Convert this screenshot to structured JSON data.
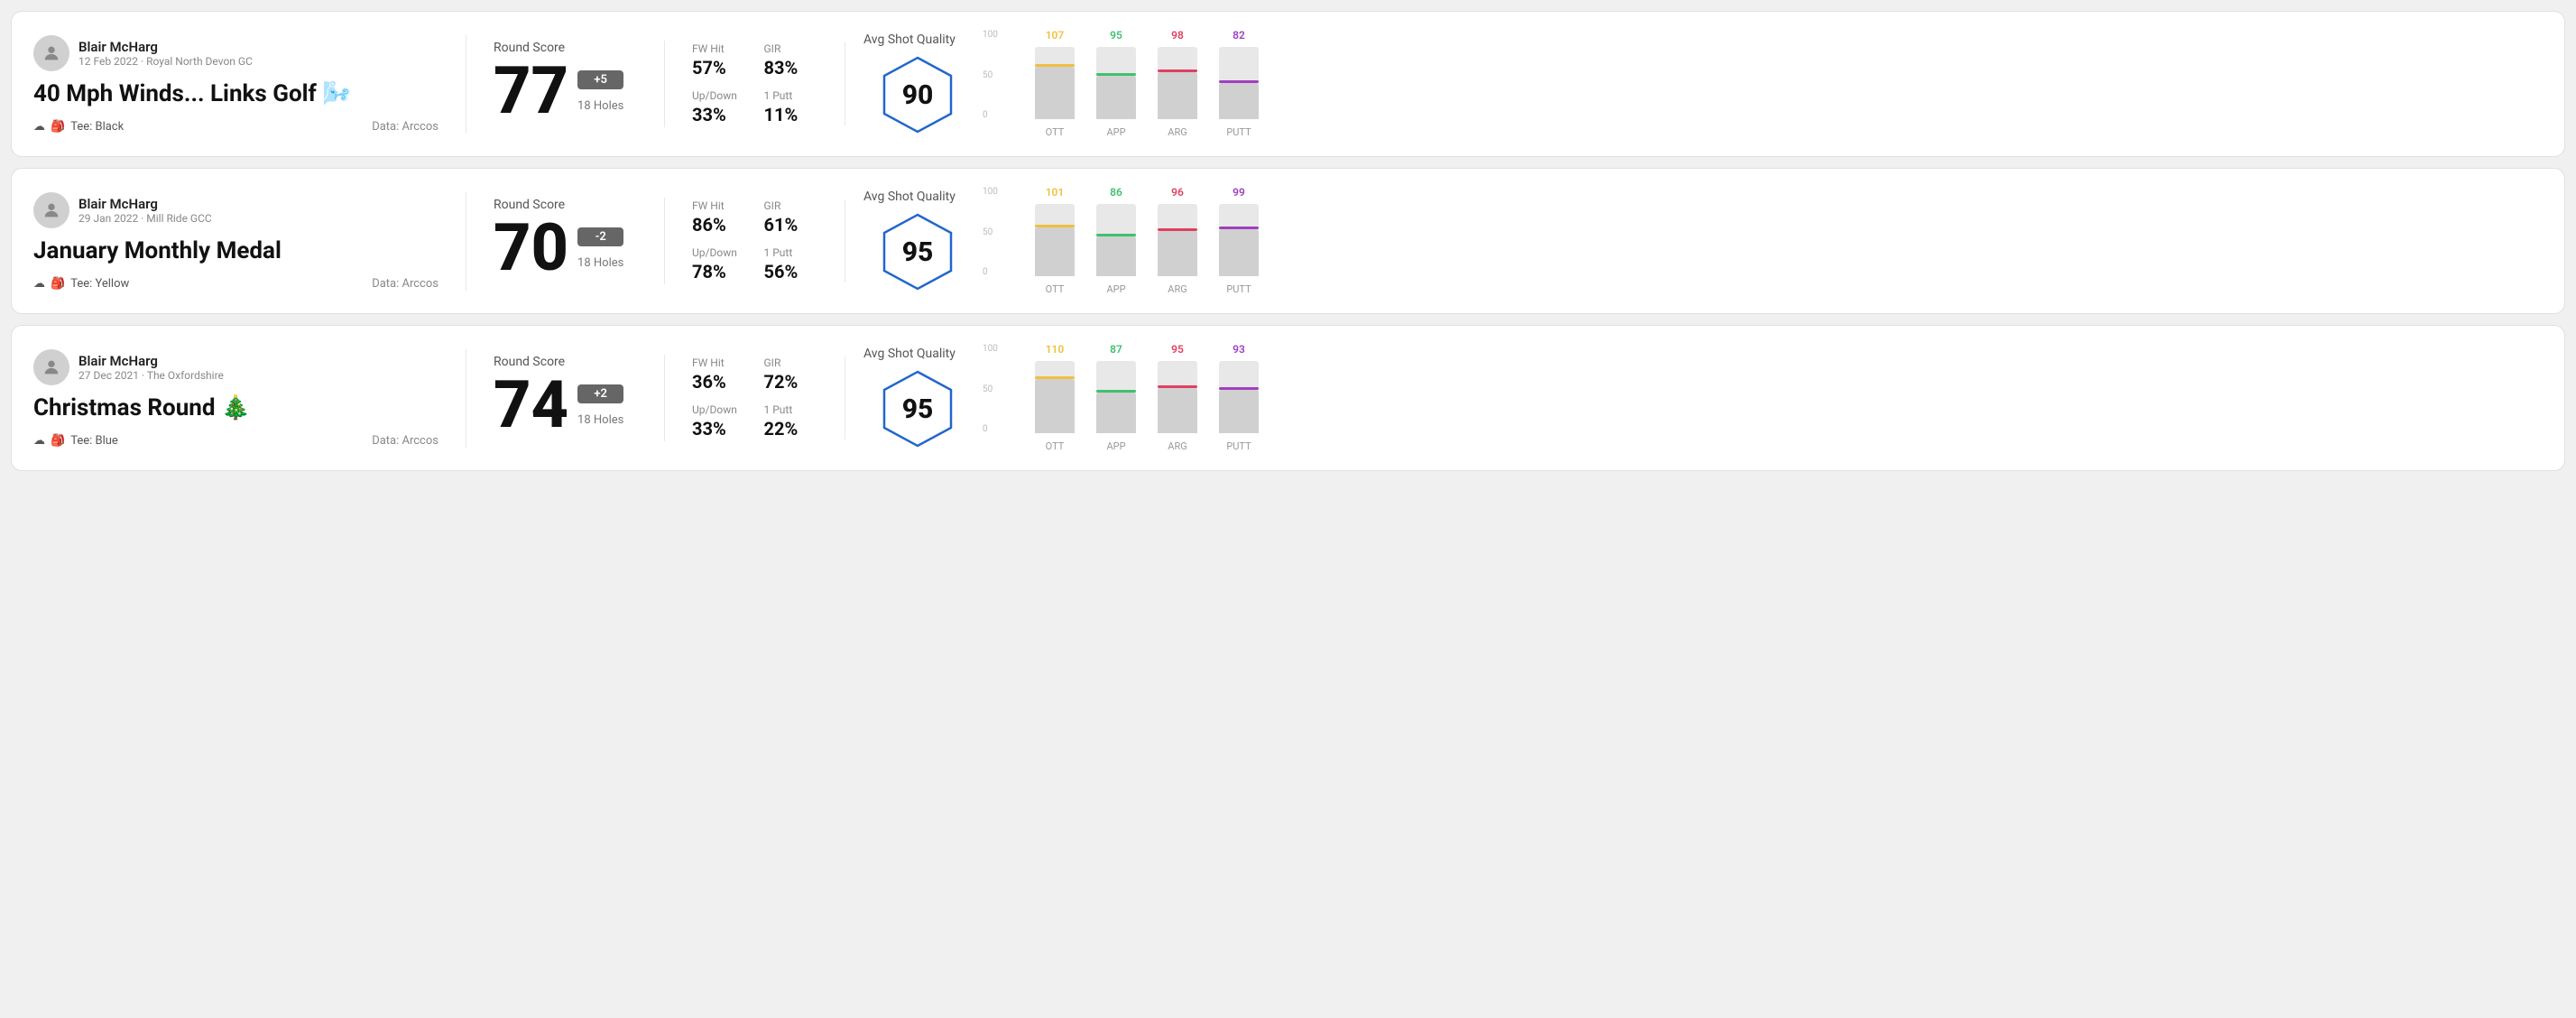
{
  "rounds": [
    {
      "id": "round1",
      "user_name": "Blair McHarg",
      "date_course": "12 Feb 2022 · Royal North Devon GC",
      "title": "40 Mph Winds... Links Golf 🌬️",
      "tee": "Black",
      "data_source": "Data: Arccos",
      "round_score_label": "Round Score",
      "score": "77",
      "score_diff": "+5",
      "score_diff_sign": "positive",
      "holes": "18 Holes",
      "fw_hit_label": "FW Hit",
      "fw_hit": "57%",
      "gir_label": "GIR",
      "gir": "83%",
      "updown_label": "Up/Down",
      "updown": "33%",
      "oneputt_label": "1 Putt",
      "oneputt": "11%",
      "quality_label": "Avg Shot Quality",
      "quality_score": "90",
      "chart": {
        "bars": [
          {
            "label": "OTT",
            "value": 107,
            "color": "#f0c040",
            "fill_pct": 72
          },
          {
            "label": "APP",
            "value": 95,
            "color": "#40c070",
            "fill_pct": 60
          },
          {
            "label": "ARG",
            "value": 98,
            "color": "#e04060",
            "fill_pct": 65
          },
          {
            "label": "PUTT",
            "value": 82,
            "color": "#a040c0",
            "fill_pct": 50
          }
        ]
      }
    },
    {
      "id": "round2",
      "user_name": "Blair McHarg",
      "date_course": "29 Jan 2022 · Mill Ride GCC",
      "title": "January Monthly Medal",
      "tee": "Yellow",
      "data_source": "Data: Arccos",
      "round_score_label": "Round Score",
      "score": "70",
      "score_diff": "-2",
      "score_diff_sign": "negative",
      "holes": "18 Holes",
      "fw_hit_label": "FW Hit",
      "fw_hit": "86%",
      "gir_label": "GIR",
      "gir": "61%",
      "updown_label": "Up/Down",
      "updown": "78%",
      "oneputt_label": "1 Putt",
      "oneputt": "56%",
      "quality_label": "Avg Shot Quality",
      "quality_score": "95",
      "chart": {
        "bars": [
          {
            "label": "OTT",
            "value": 101,
            "color": "#f0c040",
            "fill_pct": 68
          },
          {
            "label": "APP",
            "value": 86,
            "color": "#40c070",
            "fill_pct": 55
          },
          {
            "label": "ARG",
            "value": 96,
            "color": "#e04060",
            "fill_pct": 63
          },
          {
            "label": "PUTT",
            "value": 99,
            "color": "#a040c0",
            "fill_pct": 65
          }
        ]
      }
    },
    {
      "id": "round3",
      "user_name": "Blair McHarg",
      "date_course": "27 Dec 2021 · The Oxfordshire",
      "title": "Christmas Round 🎄",
      "tee": "Blue",
      "data_source": "Data: Arccos",
      "round_score_label": "Round Score",
      "score": "74",
      "score_diff": "+2",
      "score_diff_sign": "positive",
      "holes": "18 Holes",
      "fw_hit_label": "FW Hit",
      "fw_hit": "36%",
      "gir_label": "GIR",
      "gir": "72%",
      "updown_label": "Up/Down",
      "updown": "33%",
      "oneputt_label": "1 Putt",
      "oneputt": "22%",
      "quality_label": "Avg Shot Quality",
      "quality_score": "95",
      "chart": {
        "bars": [
          {
            "label": "OTT",
            "value": 110,
            "color": "#f0c040",
            "fill_pct": 75
          },
          {
            "label": "APP",
            "value": 87,
            "color": "#40c070",
            "fill_pct": 56
          },
          {
            "label": "ARG",
            "value": 95,
            "color": "#e04060",
            "fill_pct": 62
          },
          {
            "label": "PUTT",
            "value": 93,
            "color": "#a040c0",
            "fill_pct": 60
          }
        ]
      }
    }
  ],
  "y_axis_labels": [
    "100",
    "50",
    "0"
  ]
}
